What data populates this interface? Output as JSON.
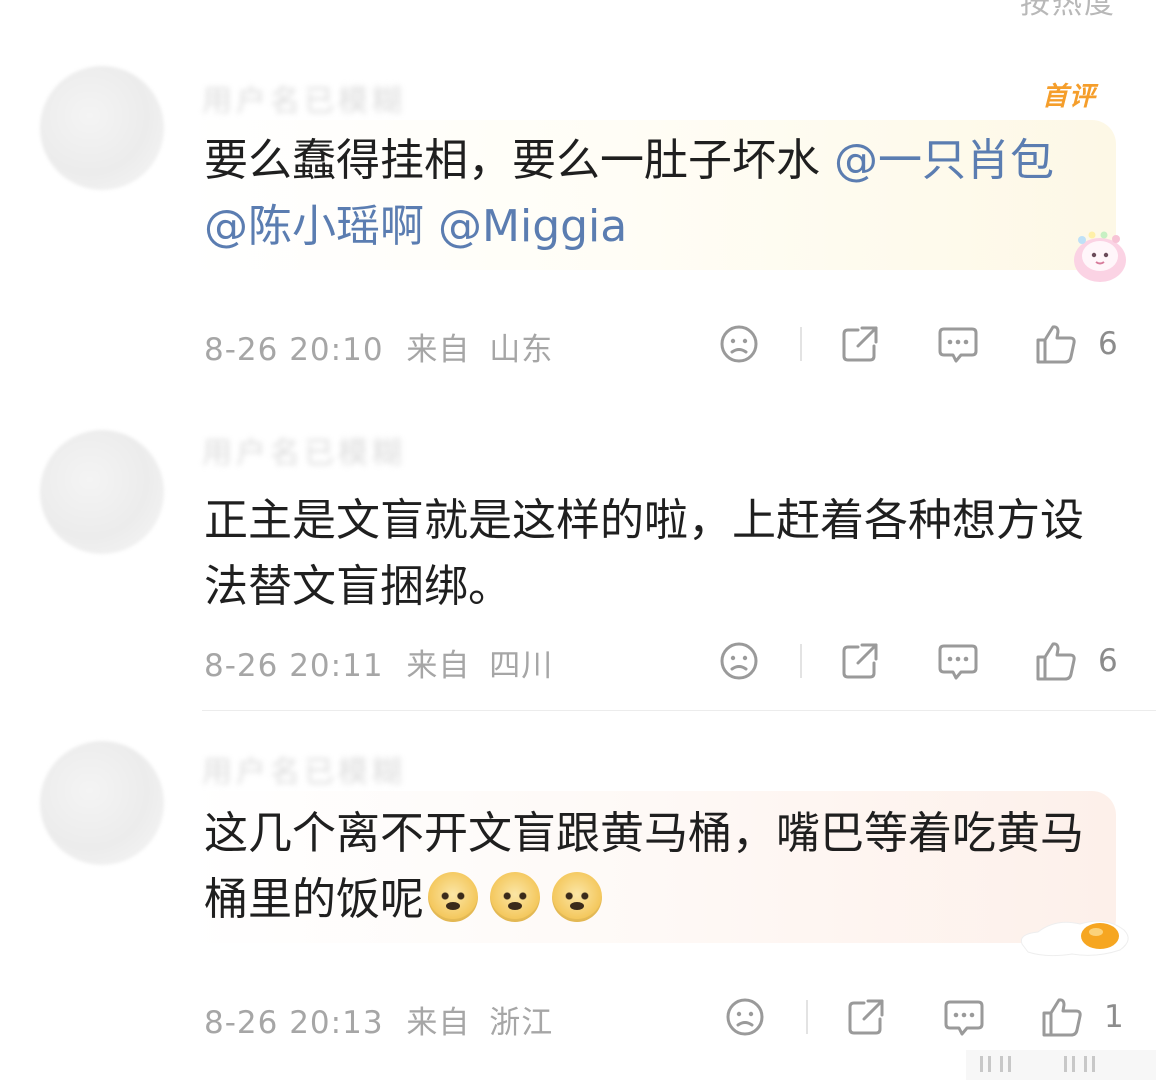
{
  "header": {
    "partial_link": "按热度"
  },
  "comments": [
    {
      "username": "用户名已模糊",
      "badge": "首评",
      "text_parts": [
        "要么蠢得挂相，要么一肚子坏水 ",
        "@一只肖包",
        " ",
        "@陈小瑶啊",
        " ",
        "@Miggia"
      ],
      "time": "8-26 20:10",
      "from_label": "来自",
      "location": "山东",
      "like_count": "6"
    },
    {
      "username": "用户名已模糊",
      "text": "正主是文盲就是这样的啦，上赶着各种想方设法替文盲捆绑。",
      "time": "8-26 20:11",
      "from_label": "来自",
      "location": "四川",
      "like_count": "6"
    },
    {
      "username": "用户名已模糊",
      "text": "这几个离不开文盲跟黄马桶，嘴巴等着吃黄马桶里的饭呢",
      "emoji_names": [
        "doge-emoji",
        "doge-emoji",
        "doge-emoji"
      ],
      "time": "8-26 20:13",
      "from_label": "来自",
      "location": "浙江",
      "like_count": "1"
    }
  ],
  "colors": {
    "mention": "#5b7db1",
    "meta": "#a6a6a6",
    "badge": "#f59e2b",
    "icon": "#a6a6a6"
  }
}
